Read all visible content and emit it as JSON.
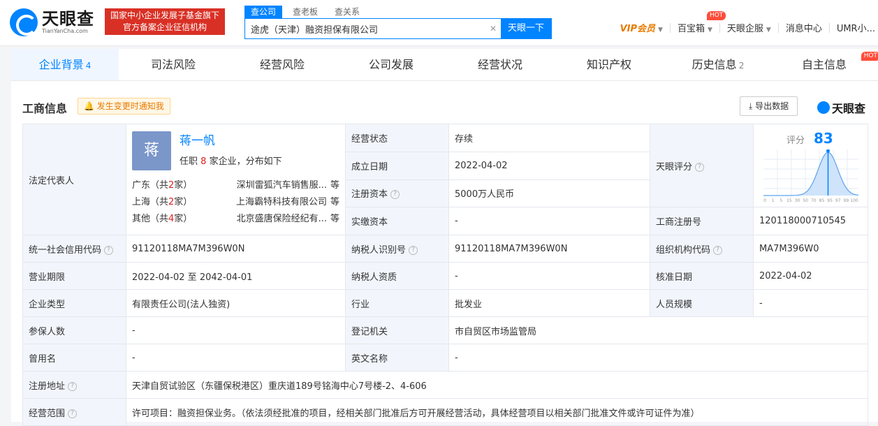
{
  "header": {
    "logo_cn": "天眼查",
    "logo_en": "TianYanCha.com",
    "gov_badge_line1": "国家中小企业发展子基金旗下",
    "gov_badge_line2": "官方备案企业征信机构",
    "search_tabs": [
      "查公司",
      "查老板",
      "查关系"
    ],
    "search_value": "途虎（天津）融资担保有限公司",
    "search_button": "天眼一下",
    "nav": {
      "vip": "VIP会员",
      "baibao": "百宝箱",
      "hot": "HOT",
      "qiye": "天眼企服",
      "messages": "消息中心",
      "user": "UMR小..."
    }
  },
  "tabs": [
    {
      "label": "企业背景",
      "count": "4"
    },
    {
      "label": "司法风险",
      "count": ""
    },
    {
      "label": "经营风险",
      "count": ""
    },
    {
      "label": "公司发展",
      "count": ""
    },
    {
      "label": "经营状况",
      "count": ""
    },
    {
      "label": "知识产权",
      "count": ""
    },
    {
      "label": "历史信息",
      "count": "2"
    },
    {
      "label": "自主信息",
      "count": "",
      "hot": "HOT"
    }
  ],
  "section": {
    "title": "工商信息",
    "notify": "发生变更时通知我",
    "export": "导出数据",
    "brand": "天眼查"
  },
  "legal_rep": {
    "label": "法定代表人",
    "avatar_char": "蒋",
    "name": "蒋一帆",
    "sub_prefix": "任职",
    "sub_count": "8",
    "sub_suffix": "家企业，分布如下",
    "regions": [
      {
        "region_prefix": "广东（共",
        "count": "2",
        "region_suffix": "家）",
        "company": "深圳雷狐汽车销售服...",
        "more": "等"
      },
      {
        "region_prefix": "上海（共",
        "count": "2",
        "region_suffix": "家）",
        "company": "上海霸特科技有限公司",
        "more": "等"
      },
      {
        "region_prefix": "其他（共",
        "count": "4",
        "region_suffix": "家）",
        "company": "北京盛唐保险经纪有...",
        "more": "等"
      }
    ]
  },
  "fields": {
    "status_label": "经营状态",
    "status": "存续",
    "founded_label": "成立日期",
    "founded": "2022-04-02",
    "capital_label": "注册资本",
    "capital": "5000万人民币",
    "paid_label": "实缴资本",
    "paid": "-",
    "score_label": "天眼评分",
    "reg_no_label": "工商注册号",
    "reg_no": "120118000710545",
    "credit_label": "统一社会信用代码",
    "credit": "91120118MA7M396W0N",
    "taxid_label": "纳税人识别号",
    "taxid": "91120118MA7M396W0N",
    "org_label": "组织机构代码",
    "org": "MA7M396W0",
    "term_label": "营业期限",
    "term": "2022-04-02  至 2042-04-01",
    "taxq_label": "纳税人资质",
    "taxq": "-",
    "approve_label": "核准日期",
    "approve": "2022-04-02",
    "type_label": "企业类型",
    "type": "有限责任公司(法人独资)",
    "industry_label": "行业",
    "industry": "批发业",
    "staff_label": "人员规模",
    "staff": "-",
    "insured_label": "参保人数",
    "insured": "-",
    "authority_label": "登记机关",
    "authority": "市自贸区市场监管局",
    "former_label": "曾用名",
    "former": "-",
    "english_label": "英文名称",
    "english": "-",
    "address_label": "注册地址",
    "address": "天津自贸试验区（东疆保税港区）重庆道189号铭海中心7号楼-2、4-606",
    "scope_label": "经营范围",
    "scope": "许可项目：融资担保业务。（依法须经批准的项目，经相关部门批准后方可开展经营活动，具体经营项目以相关部门批准文件或许可证件为准）"
  },
  "score": {
    "label": "评分",
    "value": "83",
    "ticks": [
      "0",
      "1",
      "5",
      "15",
      "30",
      "50",
      "70",
      "85",
      "95",
      "97",
      "99",
      "100"
    ],
    "marker_percentile": 0.68,
    "accent": "#0084ff"
  }
}
